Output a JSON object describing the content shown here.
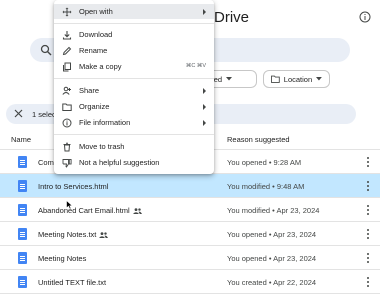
{
  "app": {
    "title_fragment": "Drive"
  },
  "search": {},
  "filters": {
    "modified_label": "odified",
    "location_label": "Location"
  },
  "selection": {
    "count_label": "1 select"
  },
  "table": {
    "col_name": "Name",
    "col_reason": "Reason suggested",
    "rows": [
      {
        "name": "Comi",
        "reason": "You opened • 9:28 AM",
        "selected": false,
        "shared": false
      },
      {
        "name": "Intro to Services.html",
        "reason": "You modified • 9:48 AM",
        "selected": true,
        "shared": false
      },
      {
        "name": "Abandoned Cart Email.html",
        "reason": "You modified • Apr 23, 2024",
        "selected": false,
        "shared": true
      },
      {
        "name": "Meeting Notes.txt",
        "reason": "You opened • Apr 23, 2024",
        "selected": false,
        "shared": true
      },
      {
        "name": "Meeting Notes",
        "reason": "You opened • Apr 23, 2024",
        "selected": false,
        "shared": false
      },
      {
        "name": "Untitled TEXT file.txt",
        "reason": "You created • Apr 22, 2024",
        "selected": false,
        "shared": false
      }
    ]
  },
  "context_menu": {
    "open_with": "Open with",
    "download": "Download",
    "rename": "Rename",
    "make_copy": "Make a copy",
    "make_copy_shortcut": "⌘C ⌘V",
    "share": "Share",
    "organize": "Organize",
    "file_info": "File information",
    "move_trash": "Move to trash",
    "not_helpful": "Not a helpful suggestion"
  },
  "colors": {
    "selected_row": "#c2e7ff",
    "accent": "#4285f4",
    "search_bg": "#e9eef6"
  }
}
